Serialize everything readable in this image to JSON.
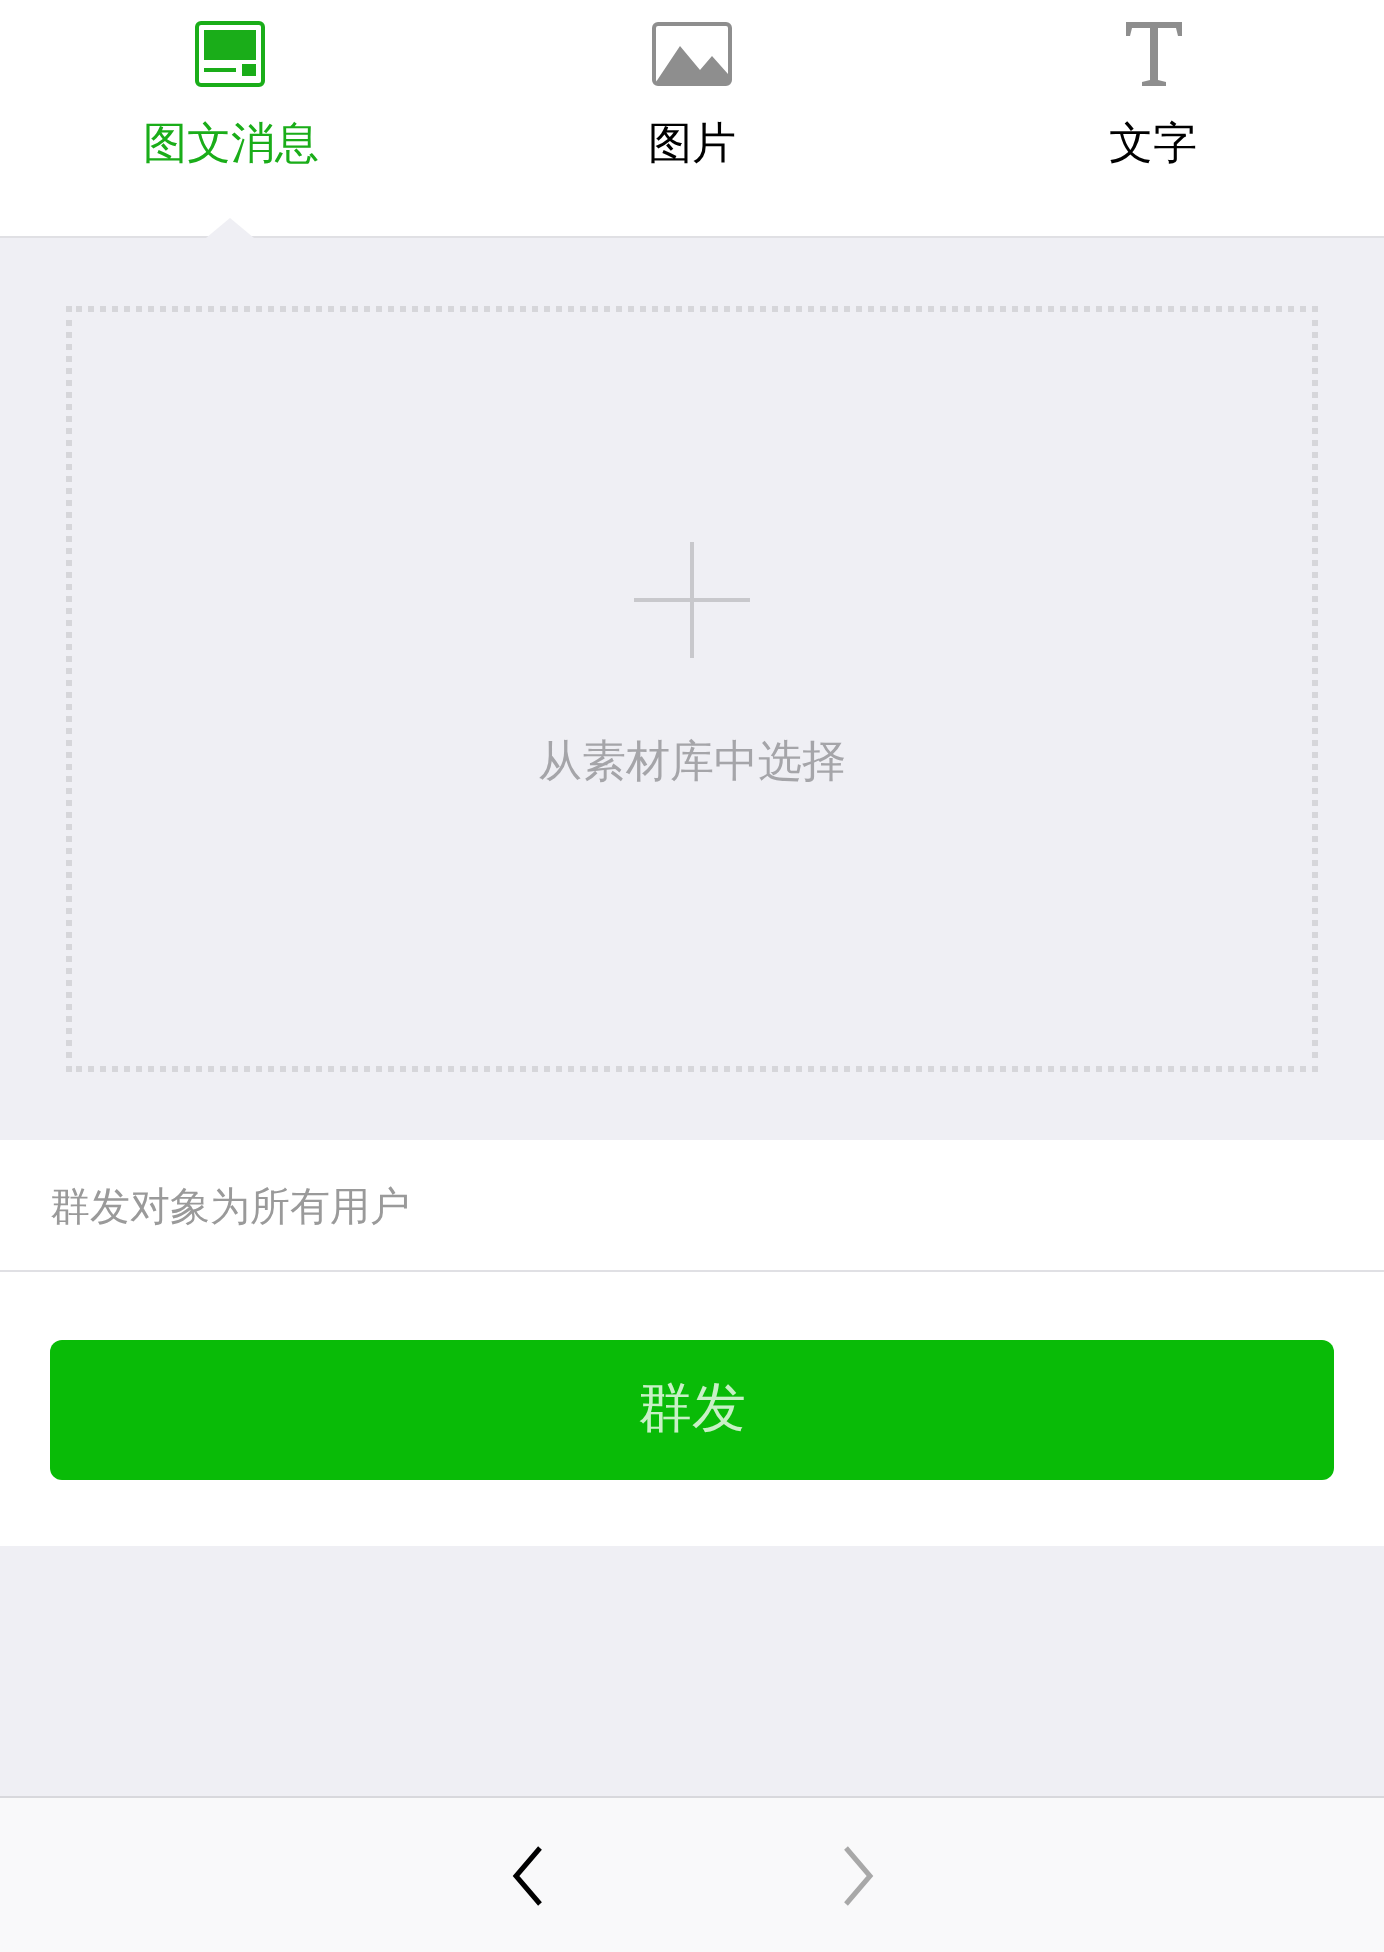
{
  "tabs": [
    {
      "label": "图文消息",
      "kind": "news",
      "selected": true
    },
    {
      "label": "图片",
      "kind": "image",
      "selected": false
    },
    {
      "label": "文字",
      "kind": "text",
      "selected": false
    }
  ],
  "picker": {
    "label": "从素材库中选择"
  },
  "audience": {
    "label": "群发对象为所有用户"
  },
  "send_button": {
    "label": "群发"
  },
  "nav": {
    "back": {
      "disabled": false
    },
    "forward": {
      "disabled": true
    }
  }
}
